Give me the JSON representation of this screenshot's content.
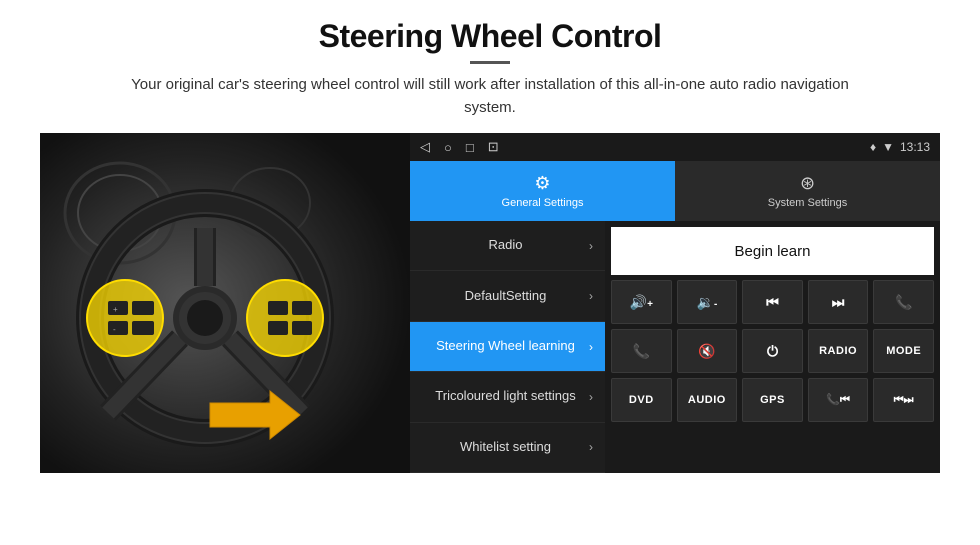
{
  "page": {
    "title": "Steering Wheel Control",
    "divider": true,
    "subtitle": "Your original car's steering wheel control will still work after installation of this all-in-one auto radio navigation system."
  },
  "status_bar": {
    "time": "13:13",
    "icons": [
      "◁",
      "○",
      "□",
      "⊡"
    ]
  },
  "tabs": [
    {
      "id": "general",
      "label": "General Settings",
      "active": true
    },
    {
      "id": "system",
      "label": "System Settings",
      "active": false
    }
  ],
  "menu_items": [
    {
      "id": "radio",
      "label": "Radio",
      "active": false
    },
    {
      "id": "default",
      "label": "DefaultSetting",
      "active": false
    },
    {
      "id": "steering",
      "label": "Steering Wheel learning",
      "active": true
    },
    {
      "id": "tricoloured",
      "label": "Tricoloured light settings",
      "active": false
    },
    {
      "id": "whitelist",
      "label": "Whitelist setting",
      "active": false
    }
  ],
  "controls": {
    "begin_learn_label": "Begin learn",
    "row1": [
      "🔊+",
      "🔊-",
      "⏮",
      "⏭",
      "📞"
    ],
    "row2": [
      "📞↩",
      "🔇",
      "⏻",
      "RADIO",
      "MODE"
    ],
    "row3": [
      "DVD",
      "AUDIO",
      "GPS",
      "📞⏮",
      "⏮⏭"
    ]
  }
}
